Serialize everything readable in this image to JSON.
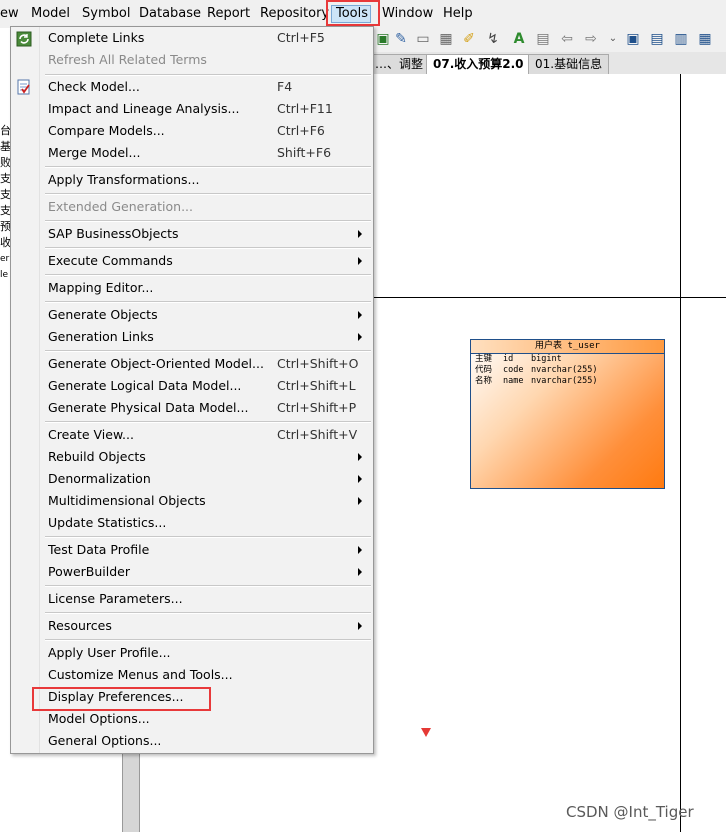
{
  "menubar": {
    "items": [
      "ew",
      "Model",
      "Symbol",
      "Database",
      "Report",
      "Repository",
      "Tools",
      "Window",
      "Help"
    ]
  },
  "tabs": [
    "…、调整",
    "07.收入预算2.0",
    "01.基础信息"
  ],
  "left_chars": [
    "台",
    "基",
    "败",
    "支",
    "支",
    "支",
    "预",
    "收",
    "er",
    "le"
  ],
  "menu": {
    "items": [
      {
        "label": "Complete Links",
        "shortcut": "Ctrl+F5"
      },
      {
        "label": "Refresh All Related Terms",
        "disabled": true
      },
      {
        "label": "Check Model...",
        "shortcut": "F4"
      },
      {
        "label": "Impact and Lineage Analysis...",
        "shortcut": "Ctrl+F11"
      },
      {
        "label": "Compare Models...",
        "shortcut": "Ctrl+F6"
      },
      {
        "label": "Merge Model...",
        "shortcut": "Shift+F6"
      },
      {
        "label": "Apply Transformations..."
      },
      {
        "label": "Extended Generation...",
        "disabled": true
      },
      {
        "label": "SAP BusinessObjects",
        "submenu": true
      },
      {
        "label": "Execute Commands",
        "submenu": true
      },
      {
        "label": "Mapping Editor..."
      },
      {
        "label": "Generate Objects",
        "submenu": true
      },
      {
        "label": "Generation Links",
        "submenu": true
      },
      {
        "label": "Generate Object-Oriented Model...",
        "shortcut": "Ctrl+Shift+O"
      },
      {
        "label": "Generate Logical Data Model...",
        "shortcut": "Ctrl+Shift+L"
      },
      {
        "label": "Generate Physical Data Model...",
        "shortcut": "Ctrl+Shift+P"
      },
      {
        "label": "Create View...",
        "shortcut": "Ctrl+Shift+V"
      },
      {
        "label": "Rebuild Objects",
        "submenu": true
      },
      {
        "label": "Denormalization",
        "submenu": true
      },
      {
        "label": "Multidimensional Objects",
        "submenu": true
      },
      {
        "label": "Update Statistics..."
      },
      {
        "label": "Test Data Profile",
        "submenu": true
      },
      {
        "label": "PowerBuilder",
        "submenu": true
      },
      {
        "label": "License Parameters..."
      },
      {
        "label": "Resources",
        "submenu": true
      },
      {
        "label": "Apply User Profile..."
      },
      {
        "label": "Customize Menus and Tools..."
      },
      {
        "label": "Display Preferences..."
      },
      {
        "label": "Model Options..."
      },
      {
        "label": "General Options..."
      }
    ]
  },
  "entity": {
    "title": "用户表 t_user",
    "rows": [
      [
        "主键",
        "id",
        "bigint"
      ],
      [
        "代码",
        "code",
        "nvarchar(255)"
      ],
      [
        "名称",
        "name",
        "nvarchar(255)"
      ]
    ]
  },
  "watermark": "CSDN @Int_Tiger",
  "colors": {
    "highlight": "#e8393a",
    "entity_fill": "#ff8f3a",
    "selected_menu": "#cce4f7"
  }
}
